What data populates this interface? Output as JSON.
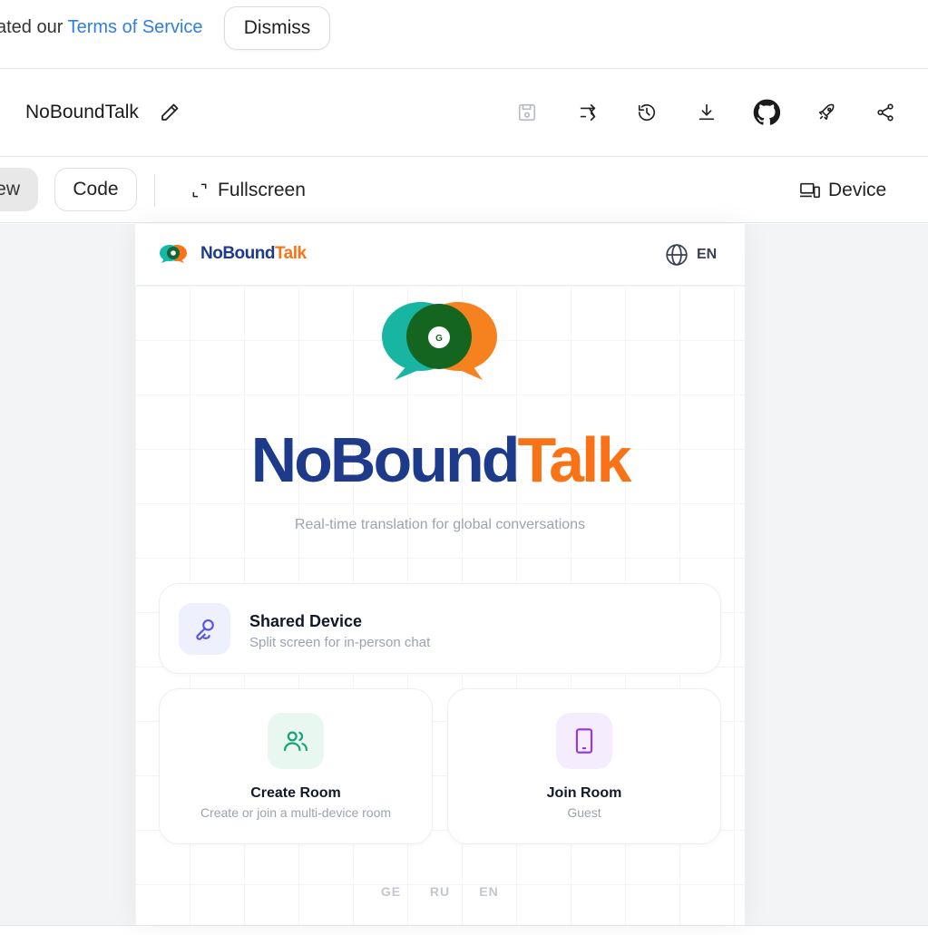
{
  "notice": {
    "text_prefix": "ated our ",
    "link_text": "Terms of Service",
    "dismiss_label": "Dismiss"
  },
  "titlebar": {
    "project_name": "NoBoundTalk",
    "icons": [
      "edit-icon",
      "save-icon",
      "remix-icon",
      "history-icon",
      "download-icon",
      "github-icon",
      "deploy-icon",
      "share-icon"
    ]
  },
  "toolbar": {
    "preview_label": "Preview",
    "code_label": "Code",
    "fullscreen_label": "Fullscreen",
    "device_label": "Device"
  },
  "app": {
    "brand_part1": "NoBound",
    "brand_part2": "Talk",
    "language": "EN",
    "logo_letter": "G",
    "hero_part1": "NoBound",
    "hero_part2": "Talk",
    "subtitle": "Real-time translation for global conversations",
    "shared_device": {
      "title": "Shared Device",
      "subtitle": "Split screen for in-person chat"
    },
    "create_room": {
      "title": "Create Room",
      "subtitle": "Create or join a multi-device room"
    },
    "join_room": {
      "title": "Join Room",
      "subtitle": "Guest"
    },
    "languages": [
      "GE",
      "RU",
      "EN"
    ],
    "colors": {
      "navy": "#1e3a8a",
      "orange": "#f97316",
      "teal": "#14b8a6",
      "dark_green": "#166534",
      "link_blue": "#2f7fdc"
    }
  }
}
